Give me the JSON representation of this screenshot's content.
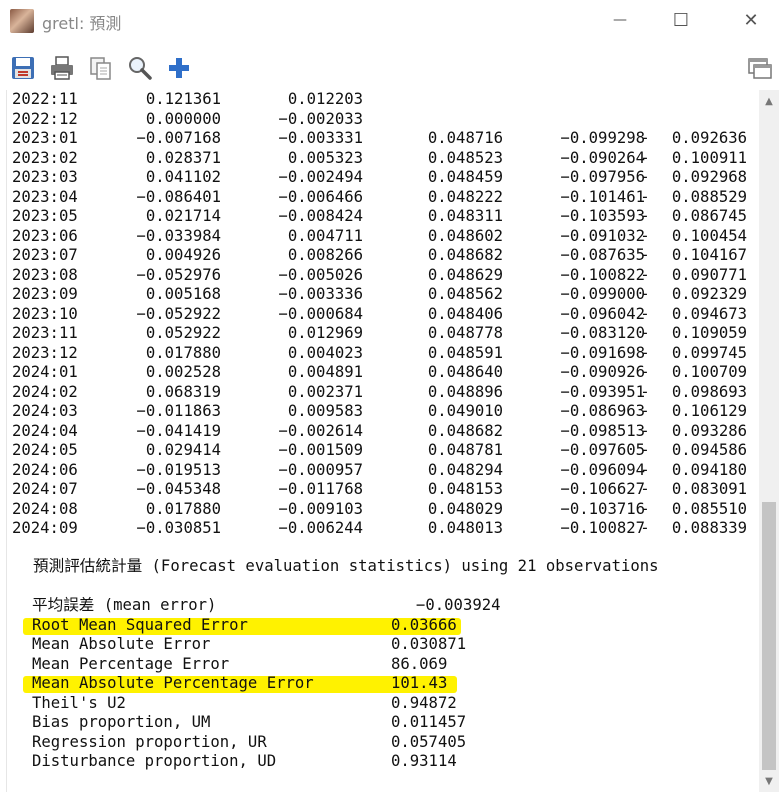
{
  "window": {
    "title": "gretl: 預測",
    "controls": {
      "minimize": "—",
      "maximize": "☐",
      "close": "✕"
    }
  },
  "toolbar": {
    "buttons": [
      {
        "name": "save-icon"
      },
      {
        "name": "print-icon"
      },
      {
        "name": "copy-icon"
      },
      {
        "name": "zoom-icon"
      },
      {
        "name": "add-icon"
      }
    ],
    "right_button": {
      "name": "windows-icon"
    }
  },
  "forecast_table": {
    "rows": [
      {
        "date": "2022:11",
        "actual": "0.121361",
        "forecast": "0.012203",
        "std_error": "",
        "lower": "",
        "dash": "",
        "upper": ""
      },
      {
        "date": "2022:12",
        "actual": "0.000000",
        "forecast": "−0.002033",
        "std_error": "",
        "lower": "",
        "dash": "",
        "upper": ""
      },
      {
        "date": "2023:01",
        "actual": "−0.007168",
        "forecast": "−0.003331",
        "std_error": "0.048716",
        "lower": "−0.099298",
        "dash": "-",
        "upper": "0.092636"
      },
      {
        "date": "2023:02",
        "actual": "0.028371",
        "forecast": "0.005323",
        "std_error": "0.048523",
        "lower": "−0.090264",
        "dash": "-",
        "upper": "0.100911"
      },
      {
        "date": "2023:03",
        "actual": "0.041102",
        "forecast": "−0.002494",
        "std_error": "0.048459",
        "lower": "−0.097956",
        "dash": "-",
        "upper": "0.092968"
      },
      {
        "date": "2023:04",
        "actual": "−0.086401",
        "forecast": "−0.006466",
        "std_error": "0.048222",
        "lower": "−0.101461",
        "dash": "-",
        "upper": "0.088529"
      },
      {
        "date": "2023:05",
        "actual": "0.021714",
        "forecast": "−0.008424",
        "std_error": "0.048311",
        "lower": "−0.103593",
        "dash": "-",
        "upper": "0.086745"
      },
      {
        "date": "2023:06",
        "actual": "−0.033984",
        "forecast": "0.004711",
        "std_error": "0.048602",
        "lower": "−0.091032",
        "dash": "-",
        "upper": "0.100454"
      },
      {
        "date": "2023:07",
        "actual": "0.004926",
        "forecast": "0.008266",
        "std_error": "0.048682",
        "lower": "−0.087635",
        "dash": "-",
        "upper": "0.104167"
      },
      {
        "date": "2023:08",
        "actual": "−0.052976",
        "forecast": "−0.005026",
        "std_error": "0.048629",
        "lower": "−0.100822",
        "dash": "-",
        "upper": "0.090771"
      },
      {
        "date": "2023:09",
        "actual": "0.005168",
        "forecast": "−0.003336",
        "std_error": "0.048562",
        "lower": "−0.099000",
        "dash": "-",
        "upper": "0.092329"
      },
      {
        "date": "2023:10",
        "actual": "−0.052922",
        "forecast": "−0.000684",
        "std_error": "0.048406",
        "lower": "−0.096042",
        "dash": "-",
        "upper": "0.094673"
      },
      {
        "date": "2023:11",
        "actual": "0.052922",
        "forecast": "0.012969",
        "std_error": "0.048778",
        "lower": "−0.083120",
        "dash": "-",
        "upper": "0.109059"
      },
      {
        "date": "2023:12",
        "actual": "0.017880",
        "forecast": "0.004023",
        "std_error": "0.048591",
        "lower": "−0.091698",
        "dash": "-",
        "upper": "0.099745"
      },
      {
        "date": "2024:01",
        "actual": "0.002528",
        "forecast": "0.004891",
        "std_error": "0.048640",
        "lower": "−0.090926",
        "dash": "-",
        "upper": "0.100709"
      },
      {
        "date": "2024:02",
        "actual": "0.068319",
        "forecast": "0.002371",
        "std_error": "0.048896",
        "lower": "−0.093951",
        "dash": "-",
        "upper": "0.098693"
      },
      {
        "date": "2024:03",
        "actual": "−0.011863",
        "forecast": "0.009583",
        "std_error": "0.049010",
        "lower": "−0.086963",
        "dash": "-",
        "upper": "0.106129"
      },
      {
        "date": "2024:04",
        "actual": "−0.041419",
        "forecast": "−0.002614",
        "std_error": "0.048682",
        "lower": "−0.098513",
        "dash": "-",
        "upper": "0.093286"
      },
      {
        "date": "2024:05",
        "actual": "0.029414",
        "forecast": "−0.001509",
        "std_error": "0.048781",
        "lower": "−0.097605",
        "dash": "-",
        "upper": "0.094586"
      },
      {
        "date": "2024:06",
        "actual": "−0.019513",
        "forecast": "−0.000957",
        "std_error": "0.048294",
        "lower": "−0.096094",
        "dash": "-",
        "upper": "0.094180"
      },
      {
        "date": "2024:07",
        "actual": "−0.045348",
        "forecast": "−0.011768",
        "std_error": "0.048153",
        "lower": "−0.106627",
        "dash": "-",
        "upper": "0.083091"
      },
      {
        "date": "2024:08",
        "actual": "0.017880",
        "forecast": "−0.009103",
        "std_error": "0.048029",
        "lower": "−0.103716",
        "dash": "-",
        "upper": "0.085510"
      },
      {
        "date": "2024:09",
        "actual": "−0.030851",
        "forecast": "−0.006244",
        "std_error": "0.048013",
        "lower": "−0.100827",
        "dash": "-",
        "upper": "0.088339"
      }
    ]
  },
  "stats": {
    "header": "預測評估統計量 (Forecast evaluation statistics) using 21 observations",
    "items": [
      {
        "label": "平均誤差 (mean error)",
        "value": "−0.003924",
        "highlight": false
      },
      {
        "label": "Root Mean Squared Error",
        "value": "0.03666",
        "highlight": true
      },
      {
        "label": "Mean Absolute Error",
        "value": "0.030871",
        "highlight": false
      },
      {
        "label": "Mean Percentage Error",
        "value": "86.069",
        "highlight": false
      },
      {
        "label": "Mean Absolute Percentage Error",
        "value": "101.43",
        "highlight": true
      },
      {
        "label": "Theil's U2",
        "value": "0.94872",
        "highlight": false
      },
      {
        "label": "Bias proportion, UM",
        "value": "0.011457",
        "highlight": false
      },
      {
        "label": "Regression proportion, UR",
        "value": "0.057405",
        "highlight": false
      },
      {
        "label": "Disturbance proportion, UD",
        "value": "0.93114",
        "highlight": false
      }
    ],
    "highlight_color": "#fff200"
  },
  "scrollbar": {
    "position_fraction": 0.6
  }
}
